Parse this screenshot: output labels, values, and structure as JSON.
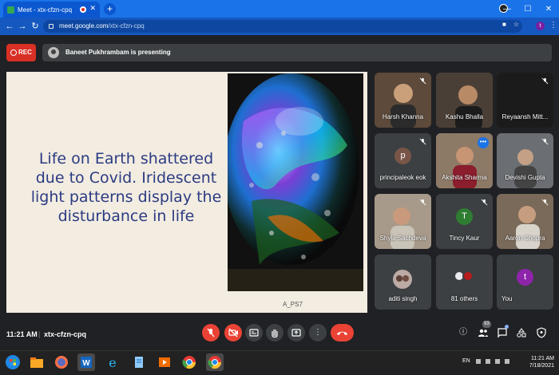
{
  "browser": {
    "tab_title": "Meet - xtx-cfzn-cpq",
    "new_tab": "+",
    "url_host": "meet.google.com",
    "url_path": "/xtx-cfzn-cpq",
    "profile_initial": "t",
    "window_controls": [
      "—",
      "☐",
      "✕"
    ]
  },
  "meet": {
    "rec_label": "REC",
    "presenter_banner": "Baneet Pukhrambam is presenting",
    "slide": {
      "text": "Life on Earth shattered due to Covid. Iridescent light patterns display the disturbance in life",
      "caption": "A_PS7"
    },
    "participants": [
      {
        "name": "Harsh Khanna",
        "type": "video",
        "muted": true
      },
      {
        "name": "Kashu Bhalla",
        "type": "video",
        "muted": false
      },
      {
        "name": "Reyaansh Mitt...",
        "type": "video",
        "muted": true
      },
      {
        "name": "principaleok eok",
        "type": "initial",
        "initial": "p",
        "color": "#795548",
        "muted": true
      },
      {
        "name": "Akshita Sharma",
        "type": "video",
        "muted": false,
        "active": true
      },
      {
        "name": "Devishi Gupta",
        "type": "video",
        "muted": true
      },
      {
        "name": "Shyla Sachdeva",
        "type": "video",
        "muted": true
      },
      {
        "name": "Tincy Kaur",
        "type": "initial",
        "initial": "T",
        "color": "#2e7d32",
        "muted": true
      },
      {
        "name": "Aaron Chopra",
        "type": "video",
        "muted": true
      },
      {
        "name": "aditi singh",
        "type": "avatar",
        "muted": false
      },
      {
        "name": "81 others",
        "type": "group",
        "muted": false
      },
      {
        "name": "You",
        "type": "initial",
        "initial": "t",
        "color": "#8e24aa",
        "muted": false
      }
    ],
    "bottom": {
      "time": "11:21 AM",
      "separator": "|",
      "meeting_code": "xtx-cfzn-cpq",
      "participant_count": "93"
    }
  },
  "taskbar": {
    "lang": "EN",
    "clock_time": "11:21 AM",
    "clock_date": "7/18/2021"
  },
  "colors": {
    "chrome_blue": "#1a73e8",
    "meet_bg": "#202124",
    "tile_bg": "#3c4043",
    "rec_red": "#d93025",
    "slide_text": "#2b3b82"
  }
}
